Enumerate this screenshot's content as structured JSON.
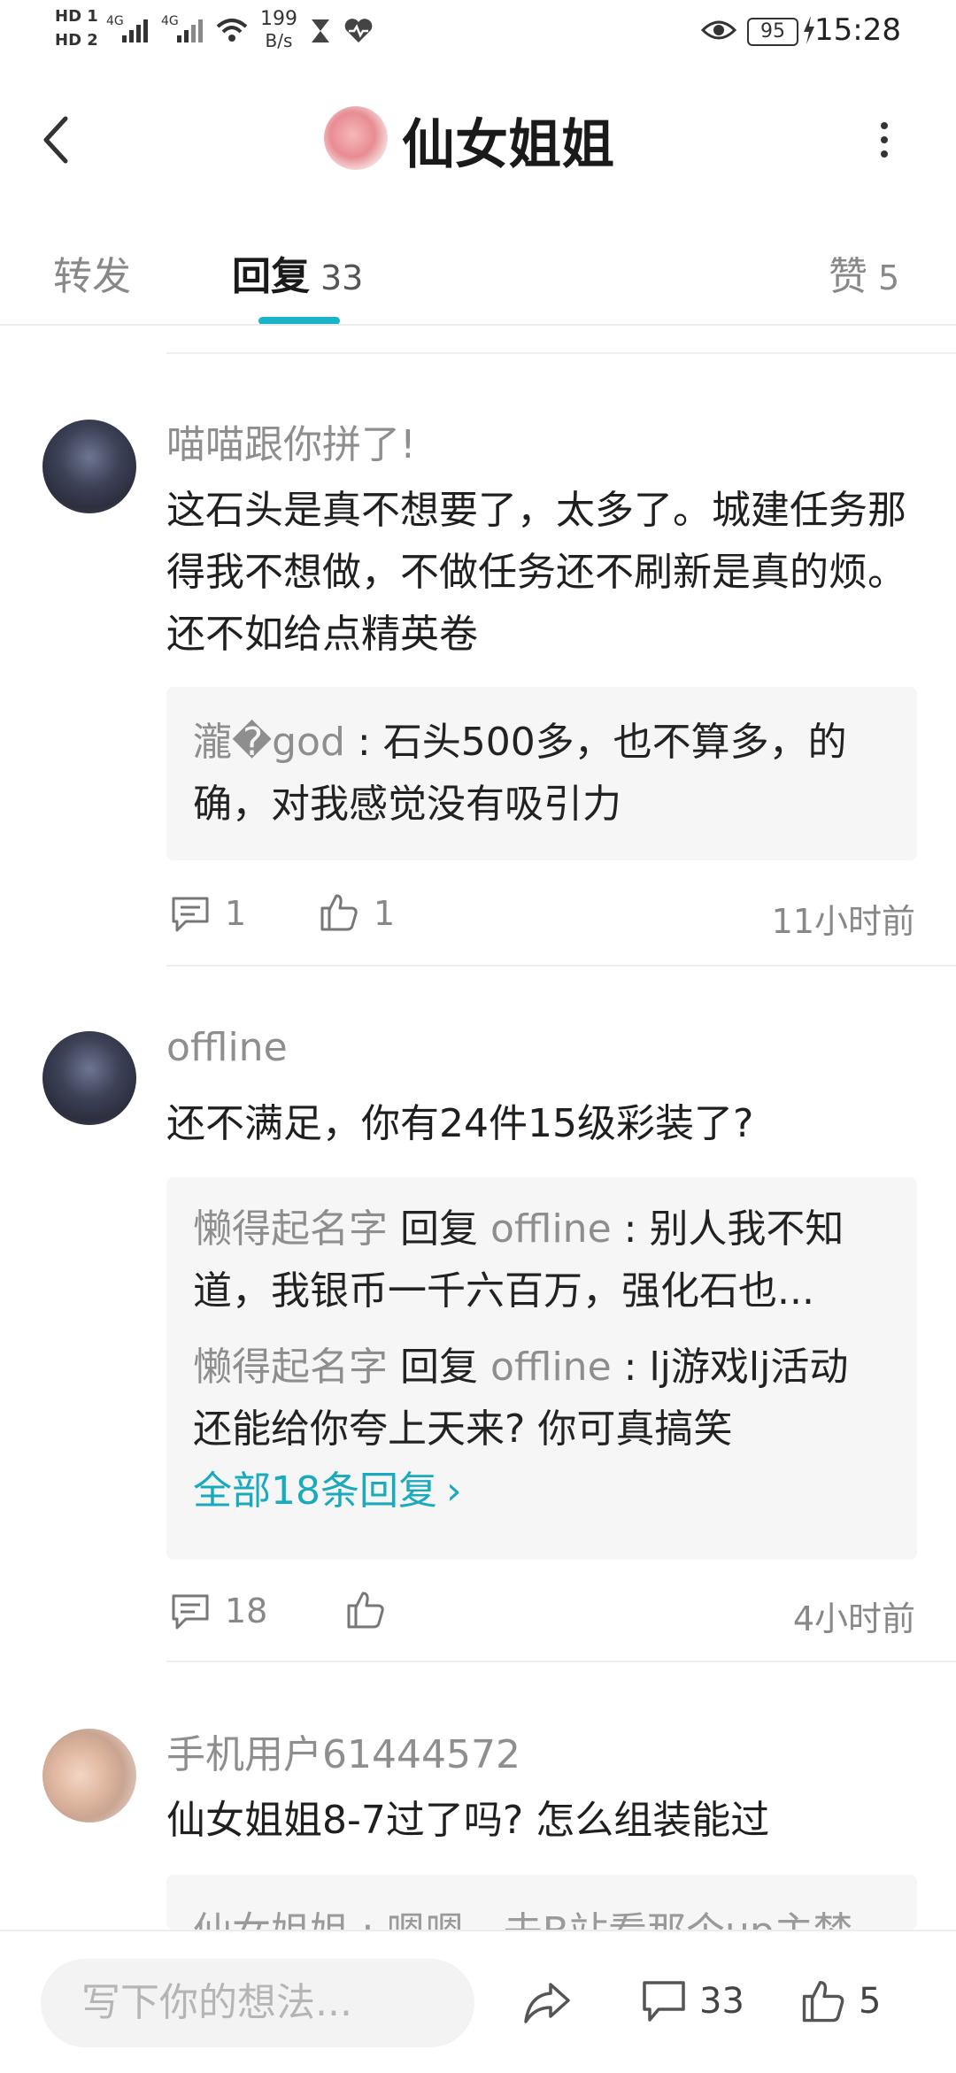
{
  "status_bar": {
    "sim1": "HD 1",
    "sim2": "HD 2",
    "net1": "4G",
    "net2": "4G",
    "speed_value": "199",
    "speed_unit": "B/s",
    "battery": "95",
    "time": "15:28"
  },
  "header": {
    "title": "仙女姐姐",
    "back_icon": "chevron-left-icon",
    "more_icon": "more-vertical-icon"
  },
  "tabs": {
    "forward": "转发",
    "reply": "回复",
    "reply_count": "33",
    "like": "赞",
    "like_count": "5",
    "active": "reply",
    "accent_color": "#19b4c6"
  },
  "comments": [
    {
      "user": "喵喵跟你拼了!",
      "text": "这石头是真不想要了，太多了。城建任务那得我不想做，不做任务还不刷新是真的烦。还不如给点精英卷",
      "replies": [
        {
          "user": "瀧�god",
          "text_parts": [
            " : 石头500多，也不算多，的",
            "确，对我感觉没有吸引力"
          ]
        }
      ],
      "comment_count": "1",
      "like_count": "1",
      "time": "11小时前"
    },
    {
      "user": "offline",
      "text": "还不满足，你有24件15级彩装了?",
      "replies": [
        {
          "user": "懒得起名字",
          "reply_word": "回复",
          "target": "offline",
          "text_a": " : 别人我不知",
          "text_b": "道，我银币一千六百万，强化石也..."
        },
        {
          "user": "懒得起名字",
          "reply_word": "回复",
          "target": "offline",
          "text_a": " : lj游戏lj活动",
          "text_b": "还能给你夸上天来? 你可真搞笑"
        }
      ],
      "all_replies": "全部18条回复",
      "comment_count": "18",
      "time": "4小时前"
    },
    {
      "user": "手机用户61444572",
      "text": "仙女姐姐8-7过了吗? 怎么组装能过",
      "reply_preview": "仙女姐姐 : 嗯嗯，去B站看那个up主梦"
    }
  ],
  "bottom_bar": {
    "placeholder": "写下你的想法...",
    "comment_count": "33",
    "like_count": "5"
  }
}
